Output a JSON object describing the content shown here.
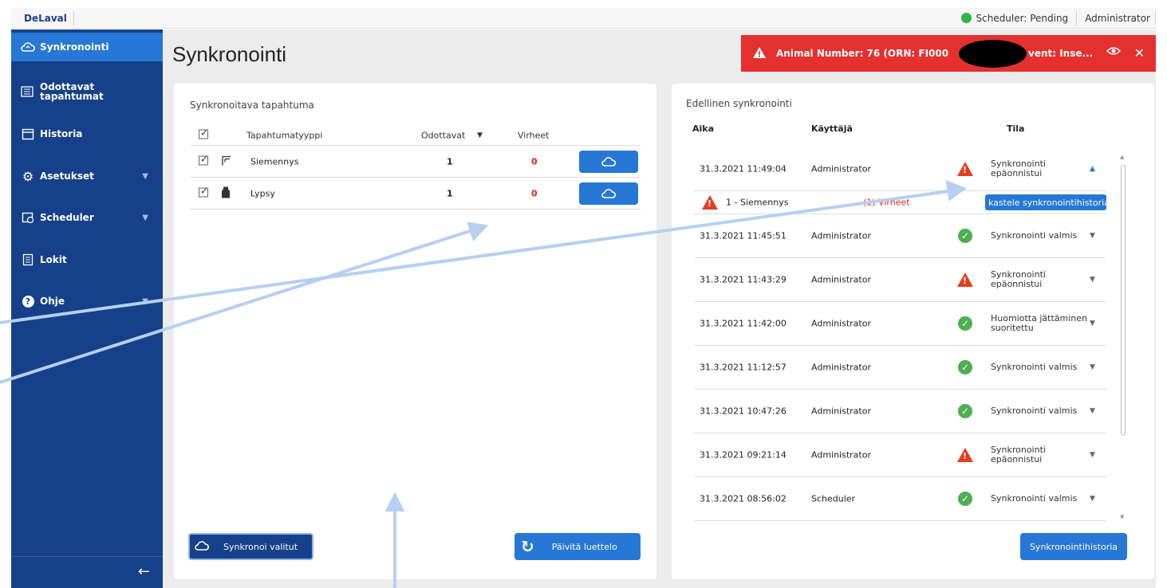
{
  "app": {
    "logo": "DeLaval"
  },
  "topbar": {
    "scheduler_status": "Scheduler: Pending",
    "user": "Administrator",
    "status_color": "#2fb34a"
  },
  "sidebar": {
    "items": [
      {
        "label": "Synkronointi",
        "icon": "cloud-sync-icon",
        "active": true
      },
      {
        "label": "Odottavat\ntapahtumat",
        "icon": "list-icon"
      },
      {
        "label": "Historia",
        "icon": "calendar-icon"
      },
      {
        "label": "Asetukset",
        "icon": "gear-icon",
        "caret": true
      },
      {
        "label": "Scheduler",
        "icon": "calendar-clock-icon",
        "caret": true
      },
      {
        "label": "Lokit",
        "icon": "log-icon"
      },
      {
        "label": "Ohje",
        "icon": "help-icon",
        "caret": true
      }
    ],
    "collapse_icon": "arrow-left-icon"
  },
  "page": {
    "title": "Synkronointi"
  },
  "alert": {
    "text": "Animal Number: 76 (ORN: FI000",
    "text_suffix": "vent: Inse...",
    "color": "#e53030"
  },
  "left_panel": {
    "title": "Synkronoitava tapahtuma",
    "headers": {
      "type": "Tapahtumatyyppi",
      "pending": "Odottavat",
      "errors": "Virheet"
    },
    "rows": [
      {
        "type": "Siemennys",
        "pending": "1",
        "errors": "0",
        "icon": "insemination-icon"
      },
      {
        "type": "Lypsy",
        "pending": "1",
        "errors": "0",
        "icon": "milk-bottle-icon"
      }
    ],
    "sync_selected": "Synkronoi valitut",
    "refresh": "Päivitä luettelo"
  },
  "right_panel": {
    "title": "Edellinen synkronointi",
    "headers": {
      "time": "Aika",
      "user": "Käyttäjä",
      "status": "Tila"
    },
    "rows": [
      {
        "time": "31.3.2021 11:49:04",
        "user": "Administrator",
        "status": "Synkronointi epäonnistui",
        "ok": false,
        "expanded": true
      },
      {
        "time": "31.3.2021 11:45:51",
        "user": "Administrator",
        "status": "Synkronointi valmis",
        "ok": true
      },
      {
        "time": "31.3.2021 11:43:29",
        "user": "Administrator",
        "status": "Synkronointi epäonnistui",
        "ok": false
      },
      {
        "time": "31.3.2021 11:42:00",
        "user": "Administrator",
        "status": "Huomiotta jättäminen suoritettu",
        "ok": true
      },
      {
        "time": "31.3.2021 11:12:57",
        "user": "Administrator",
        "status": "Synkronointi valmis",
        "ok": true
      },
      {
        "time": "31.3.2021 10:47:26",
        "user": "Administrator",
        "status": "Synkronointi valmis",
        "ok": true
      },
      {
        "time": "31.3.2021 09:21:14",
        "user": "Administrator",
        "status": "Synkronointi epäonnistui",
        "ok": false
      },
      {
        "time": "31.3.2021 08:56:02",
        "user": "Scheduler",
        "status": "Synkronointi valmis",
        "ok": true
      }
    ],
    "detail": {
      "label": "1 - Siemennys",
      "errors": "(1) Virheet",
      "button": "kastele synkronointihistoriaa"
    },
    "history_button": "Synkronointihistoria"
  }
}
